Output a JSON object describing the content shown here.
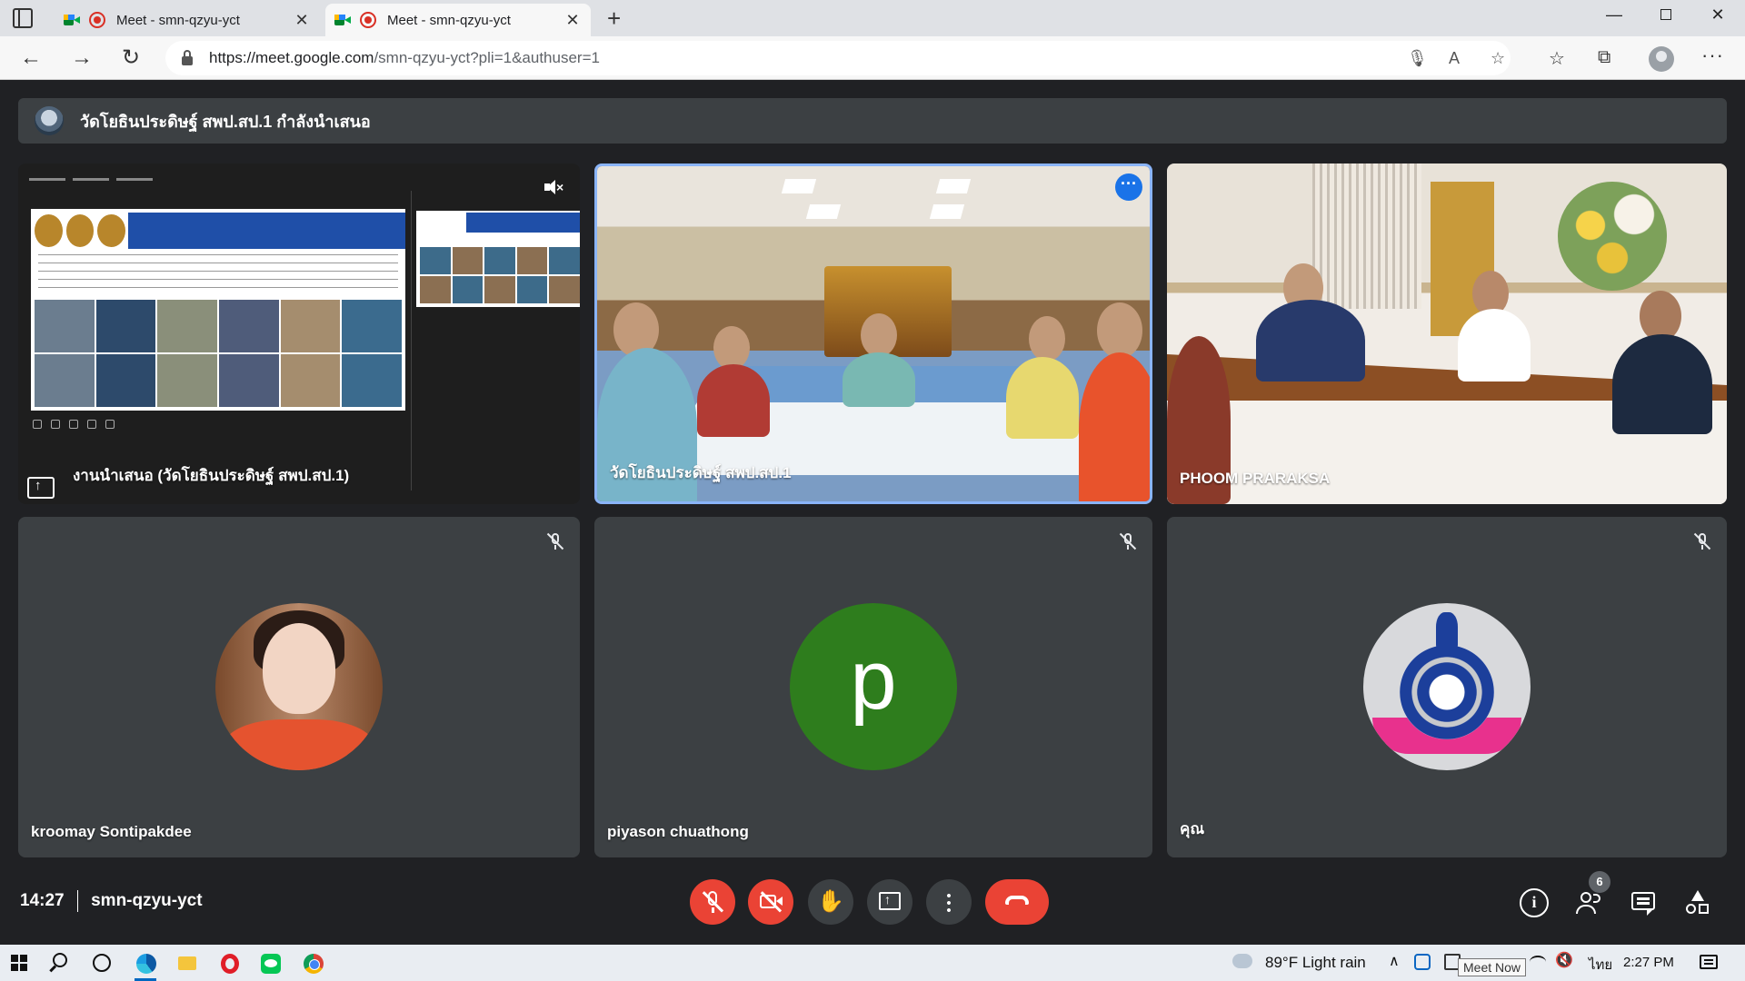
{
  "browser": {
    "tabs": [
      {
        "title": "Meet - smn-qzyu-yct",
        "active": false
      },
      {
        "title": "Meet - smn-qzyu-yct",
        "active": true
      }
    ],
    "new_tab_label": "+",
    "window_controls": {
      "minimize": "—",
      "close": "✕"
    },
    "url": {
      "host": "https://meet.google.com",
      "path": "/smn-qzyu-yct?pli=1&authuser=1"
    }
  },
  "meet": {
    "banner_text": "วัดโยธินประดิษฐ์ สพป.สป.1 กำลังนำเสนอ",
    "tiles": [
      {
        "name": "งานนำเสนอ (วัดโยธินประดิษฐ์ สพป.สป.1)",
        "kind": "presentation"
      },
      {
        "name": "วัดโยธินประดิษฐ์ สพป.สป.1",
        "kind": "video",
        "active_speaker": true
      },
      {
        "name": "PHOOM PRARAKSA",
        "kind": "video"
      },
      {
        "name": "kroomay Sontipakdee",
        "kind": "avatar-photo",
        "muted": true
      },
      {
        "name": "piyason chuathong",
        "kind": "avatar-letter",
        "initial": "p",
        "muted": true,
        "avatar_color": "#2e7d1d"
      },
      {
        "name": "คุณ",
        "kind": "avatar-logo",
        "muted": true
      }
    ],
    "controls": {
      "time": "14:27",
      "meeting_code": "smn-qzyu-yct",
      "participant_count": "6",
      "hangup_color": "#ea4335"
    }
  },
  "taskbar": {
    "weather": "89°F  Light rain",
    "tooltip": "Meet Now",
    "language": "ไทย",
    "clock": "2:27 PM"
  }
}
